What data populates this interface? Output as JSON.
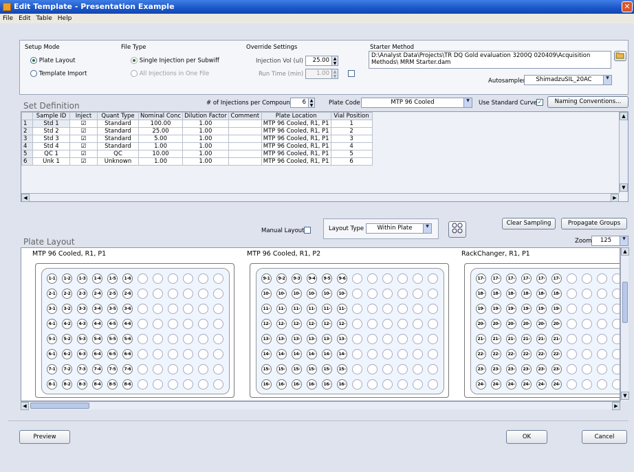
{
  "window": {
    "title": "Edit Template - Presentation Example",
    "close_glyph": "✕"
  },
  "menu": [
    "File",
    "Edit",
    "Table",
    "Help"
  ],
  "setup_mode": {
    "label": "Setup Mode",
    "options": [
      "Plate Layout",
      "Template Import"
    ],
    "selected": 0
  },
  "file_type": {
    "label": "File Type",
    "options": [
      "Single Injection per Subwiff",
      "All Injections in One File"
    ],
    "selected": 0
  },
  "override": {
    "label": "Override Settings",
    "inj_vol_label": "Injection Vol (ul)",
    "inj_vol": "25.00",
    "run_time_label": "Run Time (min)",
    "run_time": "1.00"
  },
  "starter": {
    "label": "Starter Method",
    "path": "D:\\Analyst Data\\Projects\\TR DQ Gold evaluation 3200Q 020409\\Acquisition Methods\\ MRM Starter.dam",
    "autosampler_label": "Autosampler",
    "autosampler": "ShimadzuSIL_20AC"
  },
  "set_def": {
    "title": "Set Definition",
    "injections_label": "# of Injections per Compound",
    "injections": "6",
    "plate_code_label": "Plate Code",
    "plate_code": "MTP 96 Cooled",
    "use_std_label": "Use Standard Curve",
    "use_std_checked": "✓",
    "naming_btn": "Naming Conventions...",
    "columns": [
      "Sample ID",
      "Inject",
      "Quant Type",
      "Nominal Conc",
      "Dilution Factor",
      "Comment",
      "Plate Location",
      "Vial Position"
    ],
    "rows": [
      [
        "1",
        "Std 1",
        "☑",
        "Standard",
        "100.00",
        "1.00",
        "",
        "MTP 96 Cooled, R1, P1",
        "1"
      ],
      [
        "2",
        "Std 2",
        "☑",
        "Standard",
        "25.00",
        "1.00",
        "",
        "MTP 96 Cooled, R1, P1",
        "2"
      ],
      [
        "3",
        "Std 3",
        "☑",
        "Standard",
        "5.00",
        "1.00",
        "",
        "MTP 96 Cooled, R1, P1",
        "3"
      ],
      [
        "4",
        "Std 4",
        "☑",
        "Standard",
        "1.00",
        "1.00",
        "",
        "MTP 96 Cooled, R1, P1",
        "4"
      ],
      [
        "5",
        "QC 1",
        "☑",
        "QC",
        "10.00",
        "1.00",
        "",
        "MTP 96 Cooled, R1, P1",
        "5"
      ],
      [
        "6",
        "Unk 1",
        "☑",
        "Unknown",
        "1.00",
        "1.00",
        "",
        "MTP 96 Cooled, R1, P1",
        "6"
      ]
    ]
  },
  "plate_layout": {
    "title": "Plate Layout",
    "manual_label": "Manual Layout",
    "layout_type_label": "Layout Type",
    "layout_type": "Within Plate",
    "clear_btn": "Clear Sampling",
    "propagate_btn": "Propagate Groups",
    "zoom_label": "Zoom",
    "zoom": "125",
    "plates": [
      {
        "name": "MTP 96 Cooled, R1, P1",
        "start": 1
      },
      {
        "name": "MTP 96 Cooled, R1, P2",
        "start": 9
      },
      {
        "name": "RackChanger, R1, P1",
        "start": 17
      }
    ]
  },
  "footer": {
    "preview": "Preview",
    "ok": "OK",
    "cancel": "Cancel"
  }
}
